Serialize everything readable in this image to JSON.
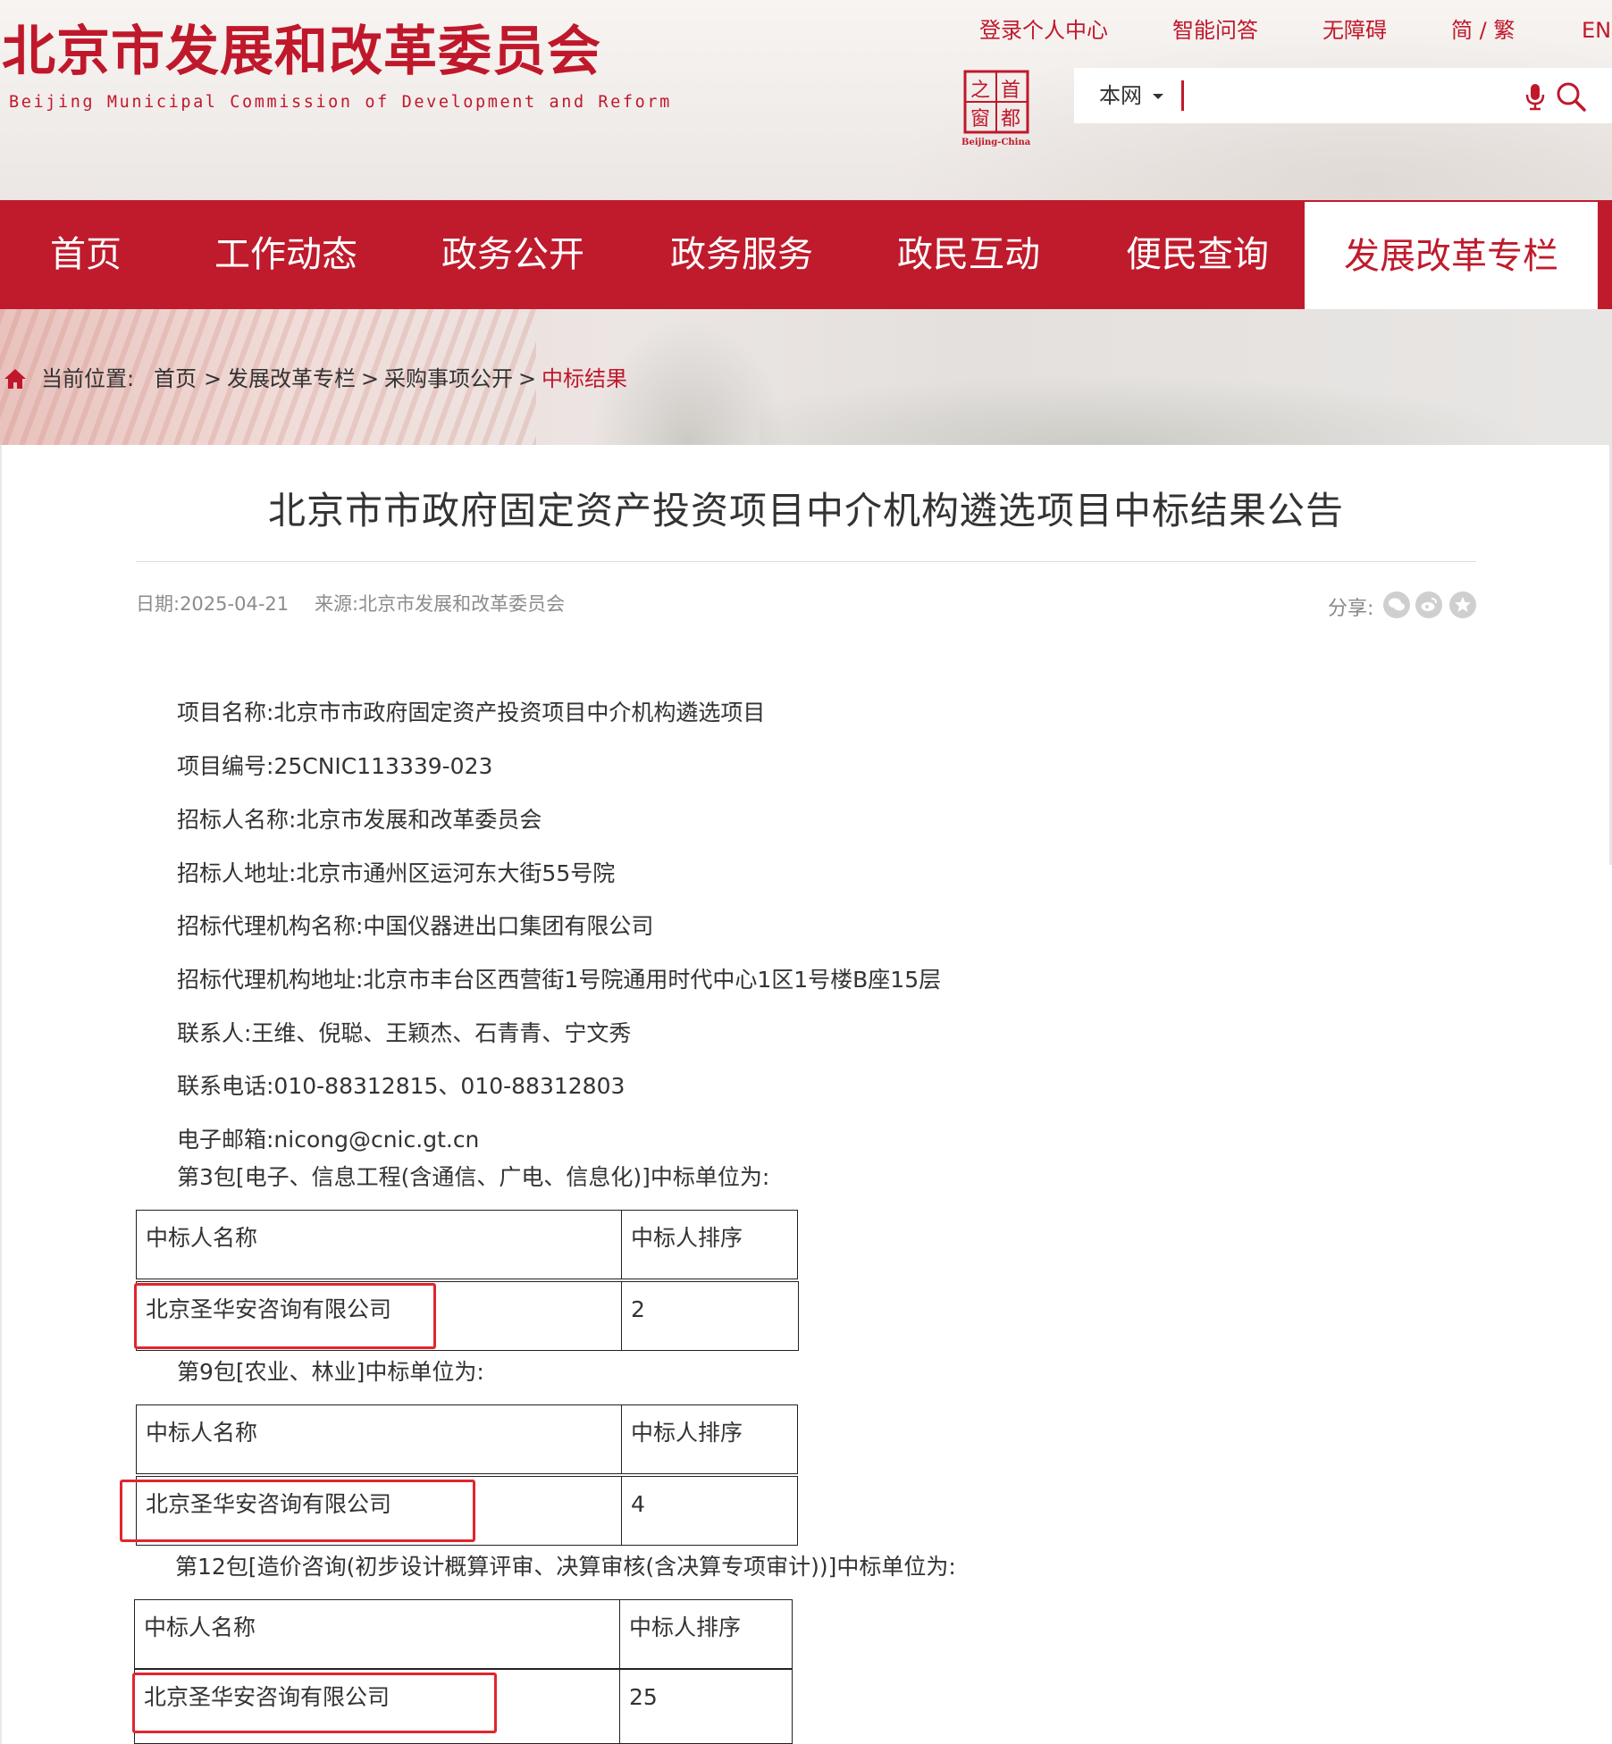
{
  "header": {
    "site_title": "北京市发展和改革委员会",
    "site_subtitle": "Beijing Municipal Commission of Development and Reform",
    "top_links": [
      "登录个人中心",
      "智能问答",
      "无障碍",
      "简 / 繁",
      "EN"
    ],
    "capital_logo": {
      "chars": [
        "之",
        "首",
        "窗",
        "都"
      ],
      "caption": "Beijing-China"
    },
    "search": {
      "scope": "本网",
      "placeholder": ""
    }
  },
  "nav": {
    "items": [
      "首页",
      "工作动态",
      "政务公开",
      "政务服务",
      "政民互动",
      "便民查询",
      "发展改革专栏"
    ],
    "active_index": 6
  },
  "breadcrumb": {
    "label": "当前位置:",
    "items": [
      "首页",
      "发展改革专栏",
      "采购事项公开",
      "中标结果"
    ],
    "separator": ">"
  },
  "article": {
    "title": "北京市市政府固定资产投资项目中介机构遴选项目中标结果公告",
    "date": "日期:2025-04-21",
    "source": "来源:北京市发展和改革委员会",
    "share_label": "分享:",
    "fields": [
      "项目名称:北京市市政府固定资产投资项目中介机构遴选项目",
      "项目编号:25CNIC113339-023",
      "招标人名称:北京市发展和改革委员会",
      "招标人地址:北京市通州区运河东大街55号院",
      "招标代理机构名称:中国仪器进出口集团有限公司",
      "招标代理机构地址:北京市丰台区西营街1号院通用时代中心1区1号楼B座15层",
      "联系人:王维、倪聪、王颖杰、石青青、宁文秀",
      "联系电话:010-88312815、010-88312803",
      "电子邮箱:nicong@cnic.gt.cn"
    ],
    "packages": [
      {
        "heading": "第3包[电子、信息工程(含通信、广电、信息化)]中标单位为:",
        "col_name": "中标人名称",
        "col_rank": "中标人排序",
        "winner": "北京圣华安咨询有限公司",
        "rank": "2"
      },
      {
        "heading": "第9包[农业、林业]中标单位为:",
        "col_name": "中标人名称",
        "col_rank": "中标人排序",
        "winner": "北京圣华安咨询有限公司",
        "rank": "4"
      },
      {
        "heading": "第12包[造价咨询(初步设计概算评审、决算审核(含决算专项审计))]中标单位为:",
        "col_name": "中标人名称",
        "col_rank": "中标人排序",
        "winner": "北京圣华安咨询有限公司",
        "rank": "25"
      }
    ]
  },
  "colors": {
    "brand_red": "#bf1b2c",
    "highlight_box": "#e0262f",
    "share_icon_bg": "#cfcfcf"
  }
}
